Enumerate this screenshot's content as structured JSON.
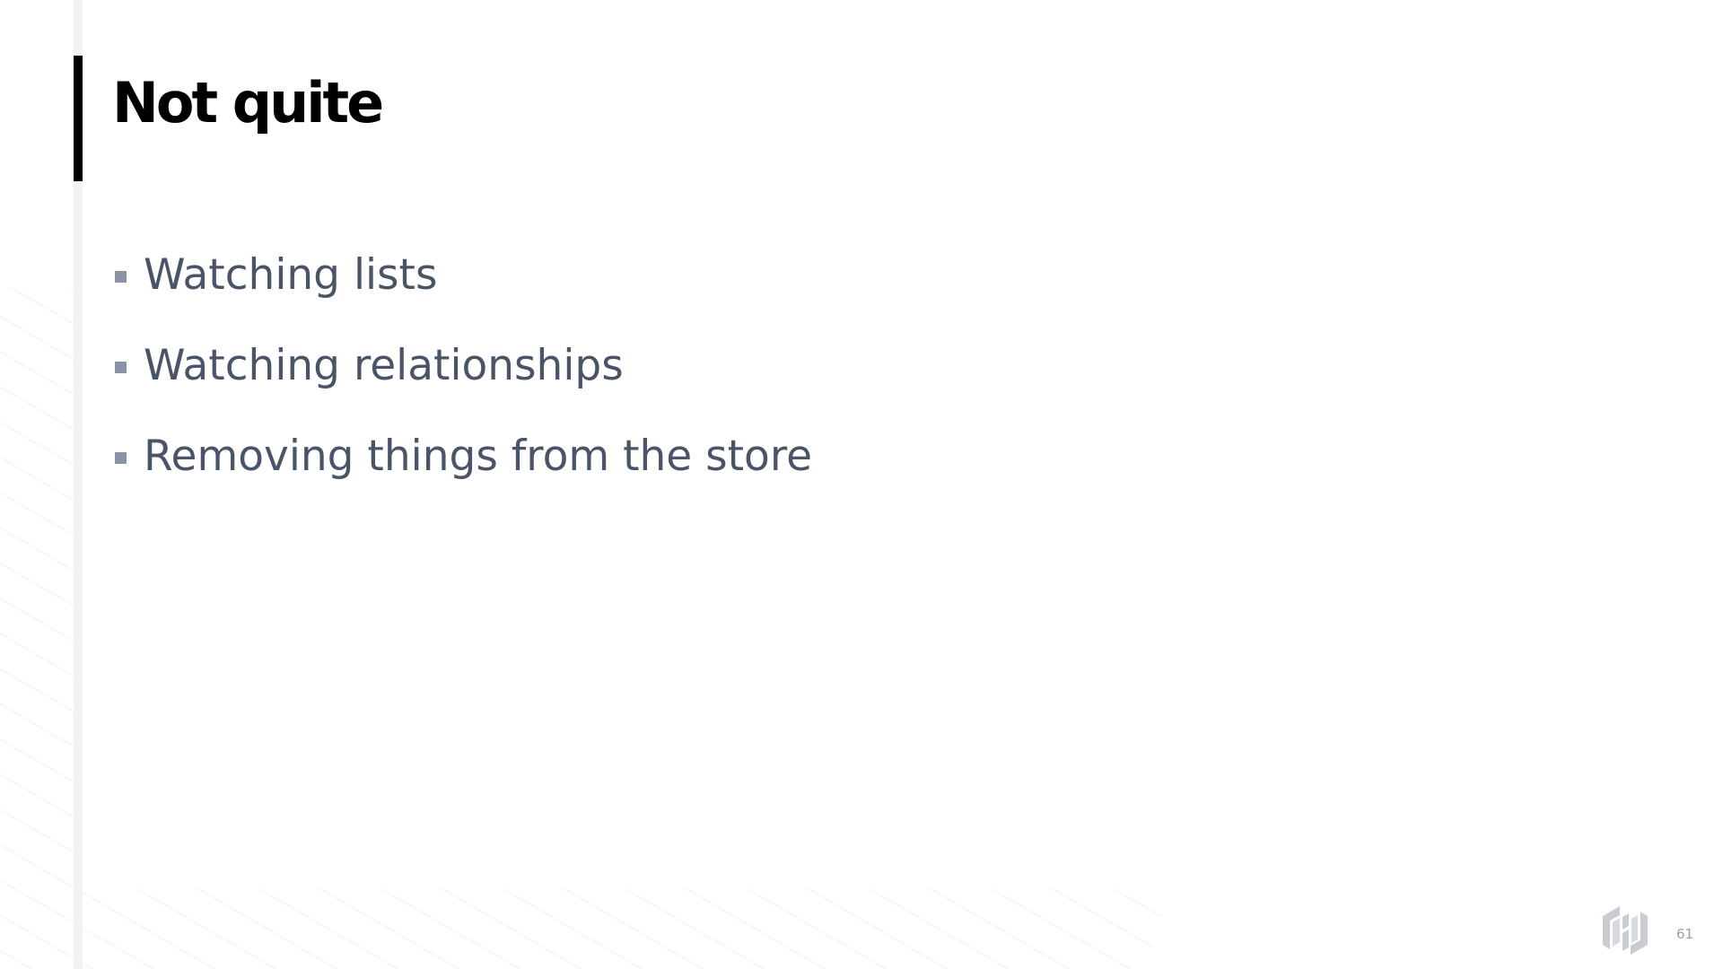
{
  "slide": {
    "title": "Not quite",
    "bullets": [
      "Watching lists",
      "Watching relationships",
      "Removing things from the store"
    ],
    "page_number": "61",
    "logo_icon": "hashicorp-logo-icon",
    "colors": {
      "title": "#000000",
      "bullet_text": "#4a5468",
      "bullet_marker": "#8a94a6",
      "accent_bar": "#000000",
      "rail": "#f2f2f2",
      "logo": "#c9ccd1"
    }
  }
}
